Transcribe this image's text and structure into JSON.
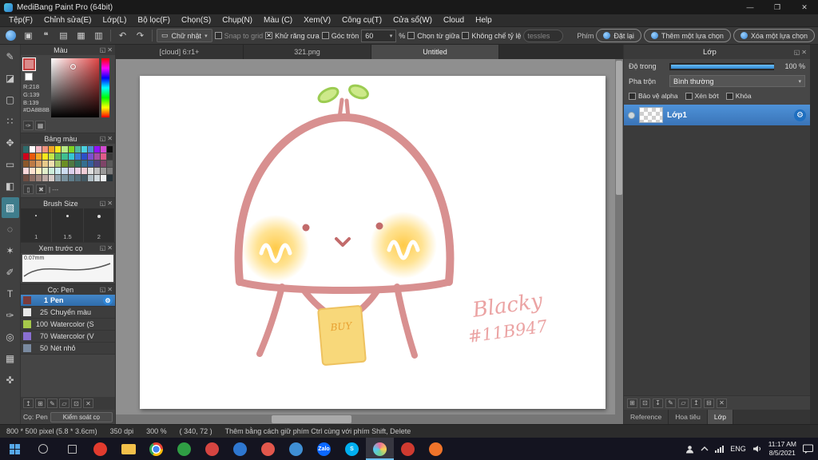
{
  "titlebar": {
    "title": "MediBang Paint Pro (64bit)"
  },
  "menubar": {
    "items": [
      "Tệp(F)",
      "Chỉnh sửa(E)",
      "Lớp(L)",
      "Bộ lọc(F)",
      "Chọn(S)",
      "Chụp(N)",
      "Màu (C)",
      "Xem(V)",
      "Công cụ(T)",
      "Cửa sổ(W)",
      "Cloud",
      "Help"
    ]
  },
  "toolbar": {
    "shape_dropdown": "Chữ nhật",
    "snap_to_grid_label": "Snap to grid",
    "antialias_label": "Khử răng cưa",
    "round_corner_label": "Góc tròn",
    "round_corner_value": "60",
    "percent_label": "%",
    "from_center_label": "Chọn từ giữa",
    "keep_ratio_label": "Không chế tỷ lệ",
    "tessles_value": "tessles",
    "phim_label": "Phím",
    "reset_label": "Đặt lại",
    "add_selection_label": "Thêm một lựa chọn",
    "remove_selection_label": "Xóa một lựa chọn"
  },
  "tools": [
    {
      "name": "pen-tool",
      "glyph": "✎"
    },
    {
      "name": "eraser-tool",
      "glyph": "◪"
    },
    {
      "name": "marquee-tool",
      "glyph": "▢"
    },
    {
      "name": "pattern-tool",
      "glyph": "∷"
    },
    {
      "name": "move-tool",
      "glyph": "✥"
    },
    {
      "name": "shape-tool",
      "glyph": "▭"
    },
    {
      "name": "bucket-tool",
      "glyph": "◧"
    },
    {
      "name": "gradient-tool",
      "glyph": "▧",
      "selected": true
    },
    {
      "name": "lasso-tool",
      "glyph": "◌"
    },
    {
      "name": "magic-wand-tool",
      "glyph": "✶"
    },
    {
      "name": "select-pen-tool",
      "glyph": "✐"
    },
    {
      "name": "text-tool",
      "glyph": "T"
    },
    {
      "name": "eyedropper-tool",
      "glyph": "✑"
    },
    {
      "name": "zoom-tool",
      "glyph": "◎"
    },
    {
      "name": "grid-tool",
      "glyph": "▦"
    },
    {
      "name": "hand-tool",
      "glyph": "✜"
    }
  ],
  "color_panel": {
    "title": "Màu",
    "r": "R:218",
    "g": "G:139",
    "b": "B:139",
    "hex": "#DA8B8B"
  },
  "palette_panel": {
    "title": "Bảng màu",
    "dashes": "| ---",
    "colors": [
      "#2e6b6b",
      "#ffffff",
      "#f5b8c4",
      "#f0927e",
      "#f5a623",
      "#f8e71c",
      "#b8e986",
      "#7ed321",
      "#50b89a",
      "#4ad1e0",
      "#4a90d2",
      "#9013fe",
      "#d24ad1",
      "#111111",
      "#d0021b",
      "#e8590c",
      "#f5a623",
      "#f8e71c",
      "#c3e64a",
      "#5cb85c",
      "#3fbf8f",
      "#36c6d3",
      "#3a7bd5",
      "#2b50c8",
      "#7b4fd1",
      "#a64ca6",
      "#e05a8a",
      "#3a3a3a",
      "#8b572a",
      "#bd7b46",
      "#d9a066",
      "#e8c98a",
      "#f0e0b0",
      "#a8c66c",
      "#6b8e23",
      "#4f7942",
      "#2f6f5f",
      "#356f8f",
      "#365f9e",
      "#50447e",
      "#7e4468",
      "#5a5a5a",
      "#f8d7da",
      "#fde2cf",
      "#fdf3c0",
      "#e2f0cb",
      "#cdeedb",
      "#cdeaf0",
      "#cddcf0",
      "#dcd0ec",
      "#ecd0e4",
      "#f0cdd6",
      "#e0e0e0",
      "#c0c0c0",
      "#9a9a9a",
      "#7a7a7a",
      "#6d4c41",
      "#8d6e63",
      "#a1887f",
      "#bcaaa4",
      "#d7ccc8",
      "#90a4ae",
      "#78909c",
      "#607d8b",
      "#546e7a",
      "#455a64",
      "#b0bec5",
      "#cfd8dc",
      "#eceff1",
      "#263238"
    ]
  },
  "brush_size_panel": {
    "title": "Brush Size",
    "sizes": [
      "1",
      "1.5",
      "2"
    ]
  },
  "preview_panel": {
    "title": "Xem trước cọ",
    "size_label": "0.07mm"
  },
  "brush_panel": {
    "title": "Cọ: Pen",
    "brushes": [
      {
        "size": "1",
        "name": "Pen",
        "chip": "#7a3b3b",
        "selected": true
      },
      {
        "size": "25",
        "name": "Chuyển màu",
        "chip": "#e8e8e8"
      },
      {
        "size": "100",
        "name": "Watercolor (S",
        "chip": "#a6c84a"
      },
      {
        "size": "70",
        "name": "Watercolor (V",
        "chip": "#8a6fd1"
      },
      {
        "size": "50",
        "name": "Nét nhỏ",
        "chip": "#7a8aa0"
      }
    ],
    "ops": [
      {
        "name": "brush-up-icon",
        "glyph": "↥"
      },
      {
        "name": "brush-new-icon",
        "glyph": "⊞"
      },
      {
        "name": "brush-edit-icon",
        "glyph": "✎"
      },
      {
        "name": "brush-folder-icon",
        "glyph": "▱"
      },
      {
        "name": "brush-cloud-icon",
        "glyph": "⊡"
      },
      {
        "name": "brush-delete-icon",
        "glyph": "✕"
      }
    ],
    "footer_label": "Cọ: Pen",
    "control_button": "Kiểm soát cọ"
  },
  "doc_tabs": [
    {
      "label": "[cloud] 6:r1+"
    },
    {
      "label": "321.png"
    },
    {
      "label": "Untitled",
      "active": true
    }
  ],
  "canvas": {
    "signature_line1": "Blacky",
    "signature_line2": "#11B947",
    "paper_text": "BUY"
  },
  "layer_panel": {
    "title": "Lớp",
    "opacity_label": "Độ trong",
    "opacity_value": "100 %",
    "blend_label": "Pha trộn",
    "blend_value": "Bình thường",
    "check_alpha": "Bảo vệ alpha",
    "check_clip": "Xén bớt",
    "check_lock": "Khóa",
    "layers": [
      {
        "name": "Lớp1",
        "selected": true
      }
    ],
    "ops": [
      {
        "name": "new-layer-icon",
        "glyph": "⊞"
      },
      {
        "name": "duplicate-layer-icon",
        "glyph": "⊡"
      },
      {
        "name": "merge-down-icon",
        "glyph": "↧"
      },
      {
        "name": "layer-menu-icon",
        "glyph": "✎"
      },
      {
        "name": "new-folder-icon",
        "glyph": "▱"
      },
      {
        "name": "move-up-icon",
        "glyph": "↥"
      },
      {
        "name": "convert-layer-icon",
        "glyph": "⊟"
      },
      {
        "name": "delete-layer-icon",
        "glyph": "✕"
      }
    ],
    "tabs": [
      {
        "label": "Reference"
      },
      {
        "label": "Hoa tiêu"
      },
      {
        "label": "Lớp",
        "active": true
      }
    ]
  },
  "status_bar": {
    "fields": [
      "800 * 500 pixel  (5.8 * 3.6cm)",
      "350 dpi",
      "300 %",
      "( 340, 72 )",
      "Thêm bằng cách giữ phím Ctrl cùng với phím Shift, Delete"
    ]
  },
  "taskbar": {
    "lang": "ENG",
    "time": "11:17 AM",
    "date": "8/5/2021",
    "apps": [
      {
        "name": "opera",
        "color": "#e23b2e"
      },
      {
        "name": "file-explorer",
        "color": "#f3c04a",
        "cls": "folder"
      },
      {
        "name": "chrome",
        "cls": "chrome"
      },
      {
        "name": "app-green",
        "color": "#2f9e44"
      },
      {
        "name": "app-red",
        "color": "#d64541"
      },
      {
        "name": "app-blue",
        "color": "#2e77d0"
      },
      {
        "name": "app-pink",
        "color": "#e2574c"
      },
      {
        "name": "edge",
        "color": "#3f8fd4"
      },
      {
        "name": "zalo",
        "color": "#0a68ff",
        "label": "Zalo"
      },
      {
        "name": "skype",
        "color": "#00aff0",
        "label": "S"
      },
      {
        "name": "medibang",
        "cls": "medibang",
        "active": true
      },
      {
        "name": "app-red-2",
        "color": "#cf3a30"
      },
      {
        "name": "app-orange",
        "color": "#f0742a"
      }
    ]
  }
}
